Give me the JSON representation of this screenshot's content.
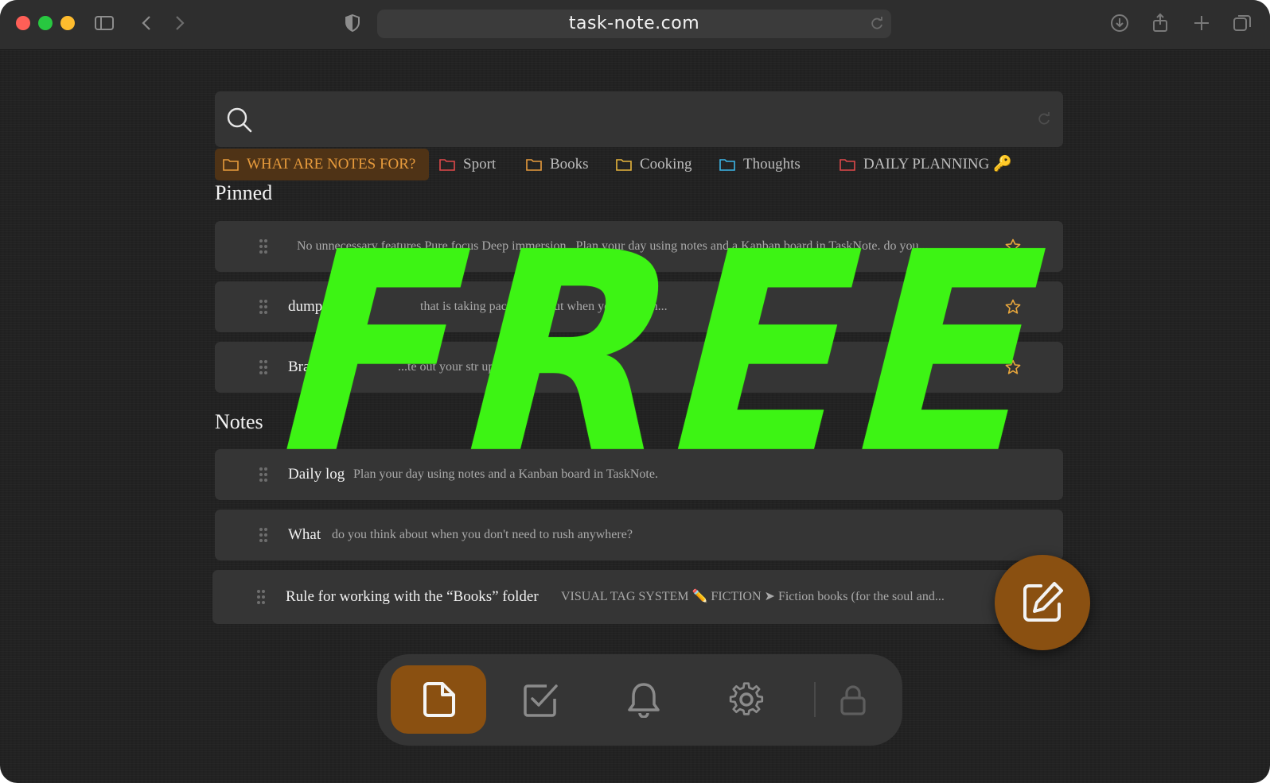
{
  "browser": {
    "url": "task-note.com"
  },
  "search": {
    "placeholder": ""
  },
  "folders": [
    {
      "label": "WHAT ARE NOTES FOR?",
      "color": "#e79b3c",
      "active": true
    },
    {
      "label": "Sport",
      "color": "#e0494a",
      "active": false
    },
    {
      "label": "Books",
      "color": "#e79b3c",
      "active": false
    },
    {
      "label": "Cooking",
      "color": "#e7b53c",
      "active": false
    },
    {
      "label": "Thoughts",
      "color": "#3cb6e7",
      "active": false
    },
    {
      "label": "DAILY PLANNING 🔑",
      "color": "#e0494a",
      "active": false
    }
  ],
  "pinned": {
    "title": "Pinned",
    "items": [
      {
        "title": "",
        "text": "No unnecessary features Pure focus Deep immersion . Plan your day using notes and a Kanban board in TaskNote. do you..."
      },
      {
        "title": "dump t",
        "text": "that is taking   pace   . do y   out when you do   rush..."
      },
      {
        "title": "Brain",
        "text": "...te out your str   up mental s   ew ideas"
      }
    ]
  },
  "notes": {
    "title": "Notes",
    "items": [
      {
        "title": "Daily log",
        "text": "Plan your day using notes and a Kanban board in TaskNote."
      },
      {
        "title": "What",
        "text": "do you think about when you don't need to rush anywhere?"
      },
      {
        "title": "Rule for working with the “Books” folder",
        "text": "VISUAL TAG SYSTEM ✏️ FICTION ➤ Fiction books (for the soul and..."
      }
    ]
  },
  "overlay": {
    "text": "FREE"
  },
  "colors": {
    "accent": "#8a5011",
    "overlay_green": "#3df414",
    "star": "#e7a63c"
  }
}
